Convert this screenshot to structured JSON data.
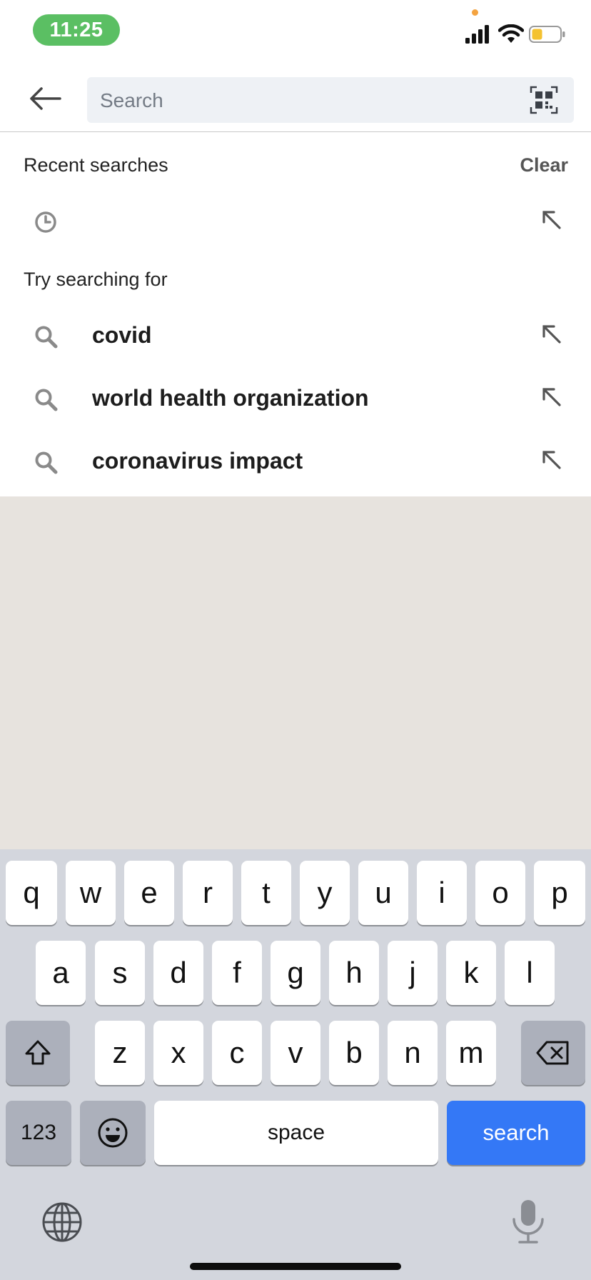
{
  "status_bar": {
    "time": "11:25",
    "icons": [
      "signal-icon",
      "wifi-icon",
      "battery-icon"
    ],
    "time_pill_color": "#5bbf63"
  },
  "header": {
    "back_icon": "back-arrow-icon",
    "search_placeholder": "Search",
    "search_value": "",
    "scan_icon": "qr-scan-icon"
  },
  "recent": {
    "title": "Recent searches",
    "clear_label": "Clear",
    "items": [
      {
        "text": "",
        "icon": "history-icon",
        "action_icon": "fill-arrow-icon"
      }
    ]
  },
  "suggestions": {
    "title": "Try searching for",
    "items": [
      {
        "text": "covid",
        "icon": "search-icon",
        "action_icon": "fill-arrow-icon"
      },
      {
        "text": "world health organization",
        "icon": "search-icon",
        "action_icon": "fill-arrow-icon"
      },
      {
        "text": "coronavirus impact",
        "icon": "search-icon",
        "action_icon": "fill-arrow-icon"
      }
    ]
  },
  "keyboard": {
    "row1": [
      "q",
      "w",
      "e",
      "r",
      "t",
      "y",
      "u",
      "i",
      "o",
      "p"
    ],
    "row2": [
      "a",
      "s",
      "d",
      "f",
      "g",
      "h",
      "j",
      "k",
      "l"
    ],
    "row3": [
      "z",
      "x",
      "c",
      "v",
      "b",
      "n",
      "m"
    ],
    "numbers_label": "123",
    "space_label": "space",
    "search_label": "search",
    "accent_color": "#3478f6",
    "icons": [
      "shift-icon",
      "backspace-icon",
      "emoji-icon",
      "globe-icon",
      "microphone-icon"
    ]
  }
}
